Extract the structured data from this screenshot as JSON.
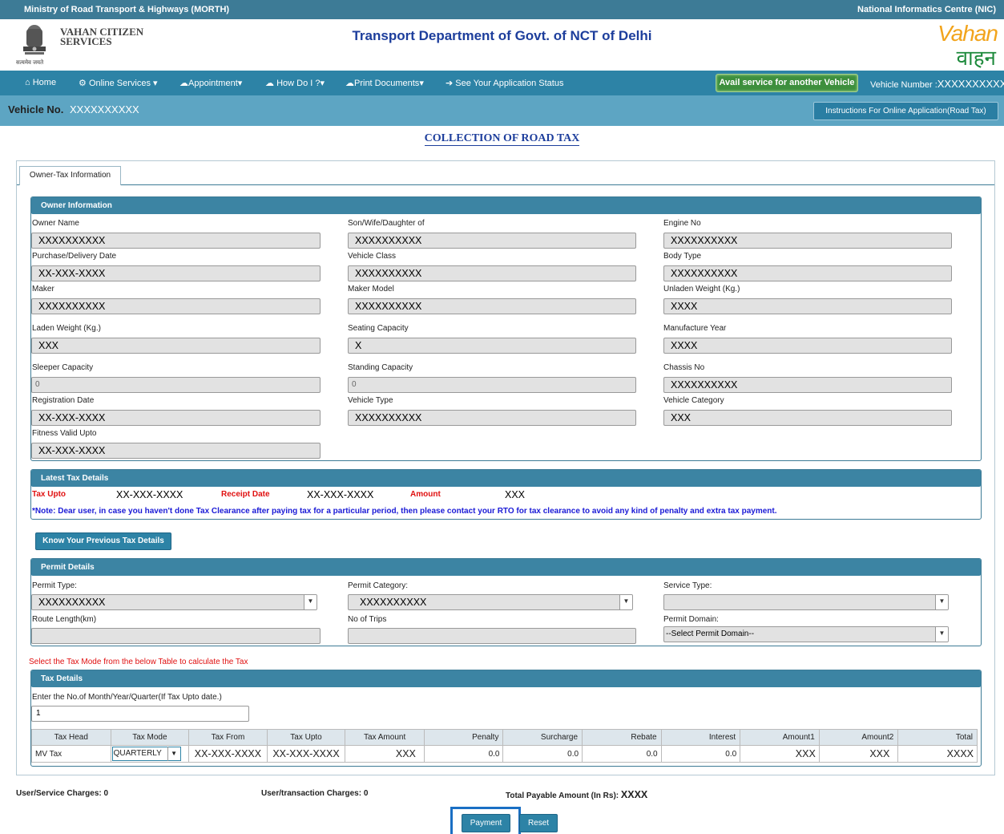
{
  "header": {
    "ministry": "Ministry of Road Transport & Highways (MORTH)",
    "nic": "National Informatics Centre (NIC)",
    "citizen_line1": "VAHAN CITIZEN",
    "citizen_line2": "SERVICES",
    "emblem_motto": "सत्यमेव जयते",
    "department": "Transport Department of Govt. of NCT of Delhi",
    "logo_top": "Vahan",
    "logo_bottom": "वाहन"
  },
  "nav": {
    "home": "Home",
    "online_services": "Online Services",
    "appointment": "Appointment",
    "how_do_i": "How Do I ?",
    "print_documents": "Print Documents",
    "application_status": "See Your Application Status",
    "avail_service": "Avail service for another Vehicle",
    "vehicle_number_label": "Vehicle Number :",
    "vehicle_number_value": "XXXXXXXXXX"
  },
  "vehicle_bar": {
    "label": "Vehicle No.",
    "value": "XXXXXXXXXX",
    "instructions_button": "Instructions For Online Application(Road Tax)"
  },
  "page_title": "COLLECTION OF ROAD TAX",
  "tab_label": "Owner-Tax Information",
  "owner": {
    "heading": "Owner Information",
    "fields": {
      "owner_name": {
        "label": "Owner Name",
        "value": "XXXXXXXXXX"
      },
      "relation": {
        "label": "Son/Wife/Daughter of",
        "value": "XXXXXXXXXX"
      },
      "engine_no": {
        "label": "Engine No",
        "value": "XXXXXXXXXX"
      },
      "purchase_date": {
        "label": "Purchase/Delivery Date",
        "value": "XX-XXX-XXXX"
      },
      "vehicle_class": {
        "label": "Vehicle Class",
        "value": "XXXXXXXXXX"
      },
      "body_type": {
        "label": "Body Type",
        "value": "XXXXXXXXXX"
      },
      "maker": {
        "label": "Maker",
        "value": "XXXXXXXXXX"
      },
      "maker_model": {
        "label": "Maker Model",
        "value": "XXXXXXXXXX"
      },
      "unladen_weight": {
        "label": "Unladen Weight (Kg.)",
        "value": "XXXX"
      },
      "laden_weight": {
        "label": "Laden Weight (Kg.)",
        "value": "XXX"
      },
      "seating_capacity": {
        "label": "Seating Capacity",
        "value": "X"
      },
      "manufacture_year": {
        "label": "Manufacture Year",
        "value": "XXXX"
      },
      "sleeper_capacity": {
        "label": "Sleeper Capacity",
        "value": "0"
      },
      "standing_capacity": {
        "label": "Standing Capacity",
        "value": "0"
      },
      "chassis_no": {
        "label": "Chassis No",
        "value": "XXXXXXXXXX"
      },
      "registration_date": {
        "label": "Registration Date",
        "value": "XX-XXX-XXXX"
      },
      "vehicle_type": {
        "label": "Vehicle Type",
        "value": "XXXXXXXXXX"
      },
      "vehicle_category": {
        "label": "Vehicle Category",
        "value": "XXX"
      },
      "fitness_upto": {
        "label": "Fitness Valid Upto",
        "value": "XX-XXX-XXXX"
      }
    }
  },
  "latest_tax": {
    "heading": "Latest Tax Details",
    "tax_upto_label": "Tax Upto",
    "tax_upto_value": "XX-XXX-XXXX",
    "receipt_label": "Receipt Date",
    "receipt_value": "XX-XXX-XXXX",
    "amount_label": "Amount",
    "amount_value": "XXX",
    "note": "*Note: Dear user, in case you haven't done Tax Clearance after paying tax for a particular period, then please contact your RTO for tax clearance to avoid any kind of penalty and extra tax payment."
  },
  "previous_tax_button": "Know Your Previous Tax Details",
  "permit": {
    "heading": "Permit Details",
    "permit_type": {
      "label": "Permit Type:",
      "value": "XXXXXXXXXX"
    },
    "permit_category": {
      "label": "Permit Category:",
      "value": "XXXXXXXXXX"
    },
    "service_type": {
      "label": "Service Type:",
      "value": ""
    },
    "route_length": {
      "label": "Route Length(km)",
      "value": ""
    },
    "no_of_trips": {
      "label": "No of Trips",
      "value": ""
    },
    "permit_domain": {
      "label": "Permit Domain:",
      "value": "--Select Permit Domain--"
    }
  },
  "tax_mode_instruction": "Select the Tax Mode from the below Table to calculate the Tax",
  "tax_details": {
    "heading": "Tax Details",
    "period_label": "Enter the No.of Month/Year/Quarter(If Tax Upto date.)",
    "period_value": "1",
    "columns": [
      "Tax Head",
      "Tax Mode",
      "Tax From",
      "Tax Upto",
      "Tax Amount",
      "Penalty",
      "Surcharge",
      "Rebate",
      "Interest",
      "Amount1",
      "Amount2",
      "Total"
    ],
    "row": {
      "tax_head": "MV Tax",
      "tax_mode": "QUARTERLY",
      "tax_from": "XX-XXX-XXXX",
      "tax_upto": "XX-XXX-XXXX",
      "tax_amount": "XXX",
      "penalty": "0.0",
      "surcharge": "0.0",
      "rebate": "0.0",
      "interest": "0.0",
      "amount1": "XXX",
      "amount2": "XXX",
      "total": "XXXX"
    }
  },
  "footer": {
    "user_service_charges": "User/Service Charges: 0",
    "user_transaction_charges": "User/transaction Charges: 0",
    "total_payable_label": "Total Payable Amount (In Rs):",
    "total_payable_value": "XXXX",
    "payment_button": "Payment",
    "reset_button": "Reset"
  }
}
